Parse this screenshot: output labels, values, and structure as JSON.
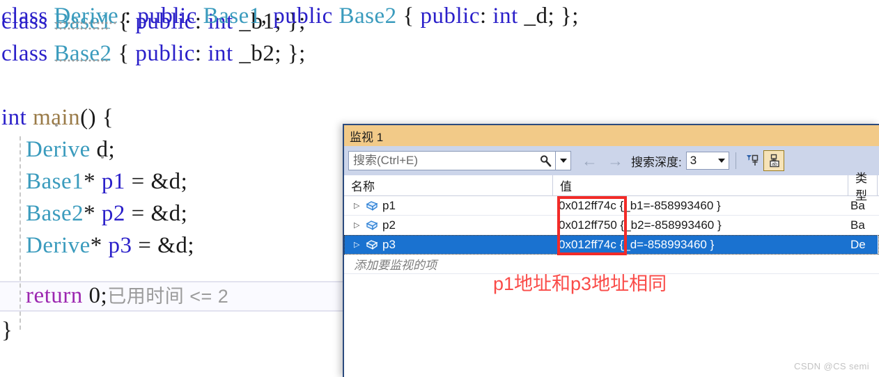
{
  "editor": {
    "lines": [
      {
        "id": "line-1",
        "tokens": [
          {
            "t": "class ",
            "cls": "kw"
          },
          {
            "t": "Base1",
            "cls": "type",
            "squiggle": true
          },
          {
            "t": " { ",
            "cls": "punct"
          },
          {
            "t": "public",
            "cls": "kw"
          },
          {
            "t": ": ",
            "cls": "punct"
          },
          {
            "t": "int",
            "cls": "kw"
          },
          {
            "t": " _b1; };",
            "cls": "plain"
          }
        ]
      },
      {
        "id": "line-2",
        "tokens": [
          {
            "t": "class ",
            "cls": "kw"
          },
          {
            "t": "Base2",
            "cls": "type",
            "squiggle": true
          },
          {
            "t": " { ",
            "cls": "punct"
          },
          {
            "t": "public",
            "cls": "kw"
          },
          {
            "t": ": ",
            "cls": "punct"
          },
          {
            "t": "int",
            "cls": "kw"
          },
          {
            "t": " _b2; };",
            "cls": "plain"
          }
        ]
      },
      {
        "id": "line-3",
        "tokens": [
          {
            "t": "class ",
            "cls": "kw"
          },
          {
            "t": "Derive",
            "cls": "type",
            "squiggle": true
          },
          {
            "t": " : ",
            "cls": "punct"
          },
          {
            "t": "public",
            "cls": "kw"
          },
          {
            "t": " ",
            "cls": "plain"
          },
          {
            "t": "Base1",
            "cls": "type"
          },
          {
            "t": ", ",
            "cls": "plain"
          },
          {
            "t": "public",
            "cls": "kw"
          },
          {
            "t": " ",
            "cls": "plain"
          },
          {
            "t": "Base2",
            "cls": "type"
          },
          {
            "t": " { ",
            "cls": "punct"
          },
          {
            "t": "public",
            "cls": "kw"
          },
          {
            "t": ": ",
            "cls": "punct"
          },
          {
            "t": "int",
            "cls": "kw"
          },
          {
            "t": " _d; };",
            "cls": "plain"
          }
        ]
      },
      {
        "id": "line-4",
        "tokens": [
          {
            "t": "int ",
            "cls": "kw"
          },
          {
            "t": "main",
            "cls": "fnname",
            "dot": true
          },
          {
            "t": "() {",
            "cls": "plain"
          }
        ]
      },
      {
        "id": "line-5",
        "tokens": [
          {
            "t": "    ",
            "cls": "plain"
          },
          {
            "t": "Derive",
            "cls": "type"
          },
          {
            "t": " ",
            "cls": "plain"
          },
          {
            "t": "d",
            "cls": "plain",
            "dot": true
          },
          {
            "t": ";",
            "cls": "plain"
          }
        ]
      },
      {
        "id": "line-6",
        "tokens": [
          {
            "t": "    ",
            "cls": "plain"
          },
          {
            "t": "Base1",
            "cls": "type"
          },
          {
            "t": "* ",
            "cls": "plain"
          },
          {
            "t": "p1",
            "cls": "varname"
          },
          {
            "t": " = &d;",
            "cls": "plain"
          }
        ]
      },
      {
        "id": "line-7",
        "tokens": [
          {
            "t": "    ",
            "cls": "plain"
          },
          {
            "t": "Base2",
            "cls": "type"
          },
          {
            "t": "* ",
            "cls": "plain"
          },
          {
            "t": "p2",
            "cls": "varname"
          },
          {
            "t": " = &d;",
            "cls": "plain"
          }
        ]
      },
      {
        "id": "line-8",
        "tokens": [
          {
            "t": "    ",
            "cls": "plain"
          },
          {
            "t": "Derive",
            "cls": "type"
          },
          {
            "t": "* ",
            "cls": "plain"
          },
          {
            "t": "p3",
            "cls": "varname"
          },
          {
            "t": " = &d;",
            "cls": "plain"
          }
        ]
      },
      {
        "id": "line-9",
        "tokens": [
          {
            "t": "    ",
            "cls": "plain"
          },
          {
            "t": "return",
            "cls": "ret"
          },
          {
            "t": " 0;",
            "cls": "plain"
          }
        ]
      },
      {
        "id": "line-10",
        "tokens": [
          {
            "t": "}",
            "cls": "plain"
          }
        ]
      }
    ],
    "elapsed_hint": "已用时间 <= 2"
  },
  "watch": {
    "title": "监视 1",
    "search": {
      "placeholder": "搜索(Ctrl+E)",
      "value": "",
      "icon": "search-icon"
    },
    "toolbar": {
      "back_arrow": "←",
      "forward_arrow": "→",
      "depth_label": "搜索深度:",
      "depth_value": "3",
      "pin_icon_1": "pin-filter-icon",
      "pin_icon_2": "pin-ab-icon"
    },
    "columns": {
      "name": "名称",
      "value": "值",
      "type": "类型"
    },
    "rows": [
      {
        "expander": "▷",
        "icon": "variable-box-icon",
        "name": "p1",
        "value": "0x012ff74c {_b1=-858993460 }",
        "type": "Ba",
        "selected": false
      },
      {
        "expander": "▷",
        "icon": "variable-box-icon",
        "name": "p2",
        "value": "0x012ff750 {_b2=-858993460 }",
        "type": "Ba",
        "selected": false
      },
      {
        "expander": "▷",
        "icon": "variable-box-icon",
        "name": "p3",
        "value": "0x012ff74c {_d=-858993460 }",
        "type": "De",
        "selected": true
      }
    ],
    "add_watch_placeholder": "添加要监视的项"
  },
  "annotation": {
    "text": "p1地址和p3地址相同",
    "color": "#fa4b48"
  },
  "watermark": "CSDN @CS semi",
  "colors": {
    "title_bar": "#f2ca88",
    "toolbar": "#ccd5ea",
    "selection": "#1a72d0",
    "highlight_rect": "#f22b28",
    "panel_border": "#2b4a7d"
  }
}
